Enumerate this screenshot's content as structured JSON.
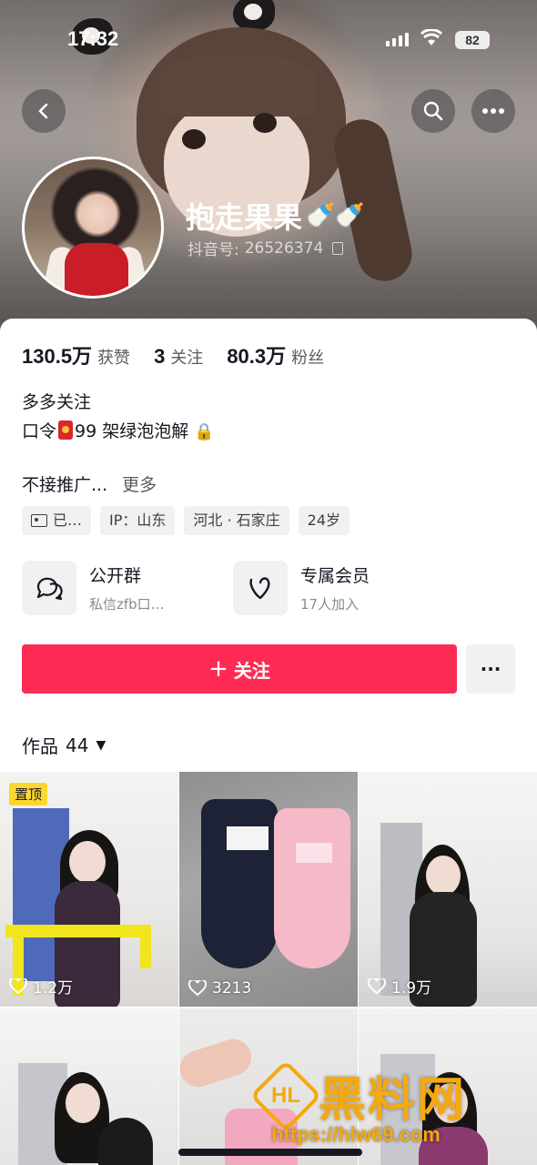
{
  "status_bar": {
    "time": "17:32",
    "battery": "82"
  },
  "profile": {
    "nickname": "抱走果果",
    "nickname_emoji": "🍼🍼",
    "douyin_id_label": "抖音号:",
    "douyin_id": "26526374"
  },
  "stats": [
    {
      "value": "130.5万",
      "label": "获赞"
    },
    {
      "value": "3",
      "label": "关注"
    },
    {
      "value": "80.3万",
      "label": "粉丝"
    }
  ],
  "bio": {
    "line1": "多多关注",
    "line2_prefix": "口令",
    "line2_suffix": "99 架绿泡泡解",
    "line3": "不接推广...",
    "more": "更多"
  },
  "tags": [
    "已…",
    "IP：山东",
    "河北 · 石家庄",
    "24岁"
  ],
  "cards": [
    {
      "title": "公开群",
      "subtitle": "私信zfb口…",
      "icon": "chat-bubbles-icon"
    },
    {
      "title": "专属会员",
      "subtitle": "17人加入",
      "icon": "vip-heart-icon"
    }
  ],
  "actions": {
    "follow": "关注",
    "follow_prefix": "+",
    "more": "···"
  },
  "works": {
    "label": "作品",
    "count": "44"
  },
  "videos": [
    {
      "pinned_label": "置顶",
      "likes": "1.2万"
    },
    {
      "likes": "3213"
    },
    {
      "likes": "1.9万"
    },
    {
      "likes": ""
    },
    {
      "likes": ""
    },
    {
      "likes": ""
    }
  ],
  "watermark": {
    "text": "黑料网",
    "url": "https://hlw69.com"
  },
  "colors": {
    "accent": "#fe2c55",
    "pin": "#fcd62e",
    "watermark": "#f5a90f"
  }
}
